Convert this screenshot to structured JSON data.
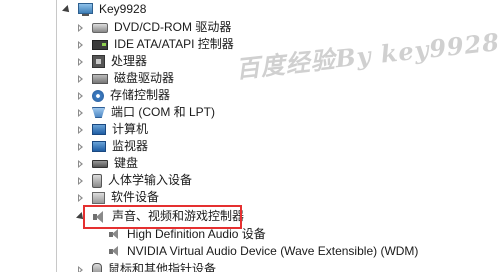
{
  "tree": {
    "root": {
      "label": "Key9928",
      "icon": "computer-icon",
      "expanded": true
    },
    "categories": [
      {
        "label": "DVD/CD-ROM 驱动器",
        "icon": "disc-drive-icon"
      },
      {
        "label": "IDE ATA/ATAPI 控制器",
        "icon": "ide-controller-icon"
      },
      {
        "label": "处理器",
        "icon": "processor-icon"
      },
      {
        "label": "磁盘驱动器",
        "icon": "disk-drive-icon"
      },
      {
        "label": "存储控制器",
        "icon": "storage-controller-icon"
      },
      {
        "label": "端口 (COM 和 LPT)",
        "icon": "port-icon"
      },
      {
        "label": "计算机",
        "icon": "computer-category-icon"
      },
      {
        "label": "监视器",
        "icon": "monitor-icon"
      },
      {
        "label": "键盘",
        "icon": "keyboard-icon"
      },
      {
        "label": "人体学输入设备",
        "icon": "hid-icon"
      },
      {
        "label": "软件设备",
        "icon": "software-device-icon"
      },
      {
        "label": "声音、视频和游戏控制器",
        "icon": "sound-controller-icon",
        "expanded": true,
        "selected": true
      },
      {
        "label": "鼠标和其他指针设备",
        "icon": "mouse-icon"
      }
    ],
    "sound_children": [
      {
        "label": "High Definition Audio 设备",
        "icon": "speaker-icon"
      },
      {
        "label": "NVIDIA Virtual Audio Device (Wave Extensible) (WDM)",
        "icon": "speaker-icon"
      }
    ]
  },
  "watermark": {
    "text": "百度经验By key9928"
  },
  "colors": {
    "highlight": "#e53030",
    "text": "#1a1a1a"
  }
}
